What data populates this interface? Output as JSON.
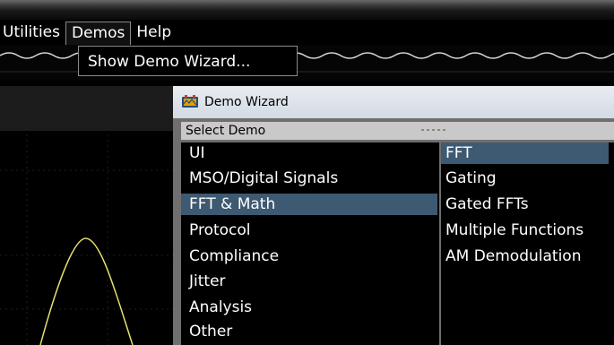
{
  "menubar": {
    "items": [
      {
        "label": "Utilities",
        "name": "menu-utilities"
      },
      {
        "label": "Demos",
        "name": "menu-demos"
      },
      {
        "label": "Help",
        "name": "menu-help"
      }
    ]
  },
  "demos_menu": {
    "show_demo_wizard": "Show Demo Wizard..."
  },
  "wizard": {
    "title": "Demo Wizard",
    "section_header": "Select Demo",
    "categories": [
      "UI",
      "MSO/Digital Signals",
      "FFT & Math",
      "Protocol",
      "Compliance",
      "Jitter",
      "Analysis",
      "Other"
    ],
    "selected_category": "FFT & Math",
    "demos": [
      "FFT",
      "Gating",
      "Gated FFTs",
      "Multiple Functions",
      "AM Demodulation"
    ],
    "selected_demo": "FFT"
  },
  "colors": {
    "selection": "#3e5972",
    "waveform": "#e7e070",
    "title_bar": "#dde3ea"
  },
  "icons": {
    "wizard_icon": "wizard-app-icon"
  }
}
